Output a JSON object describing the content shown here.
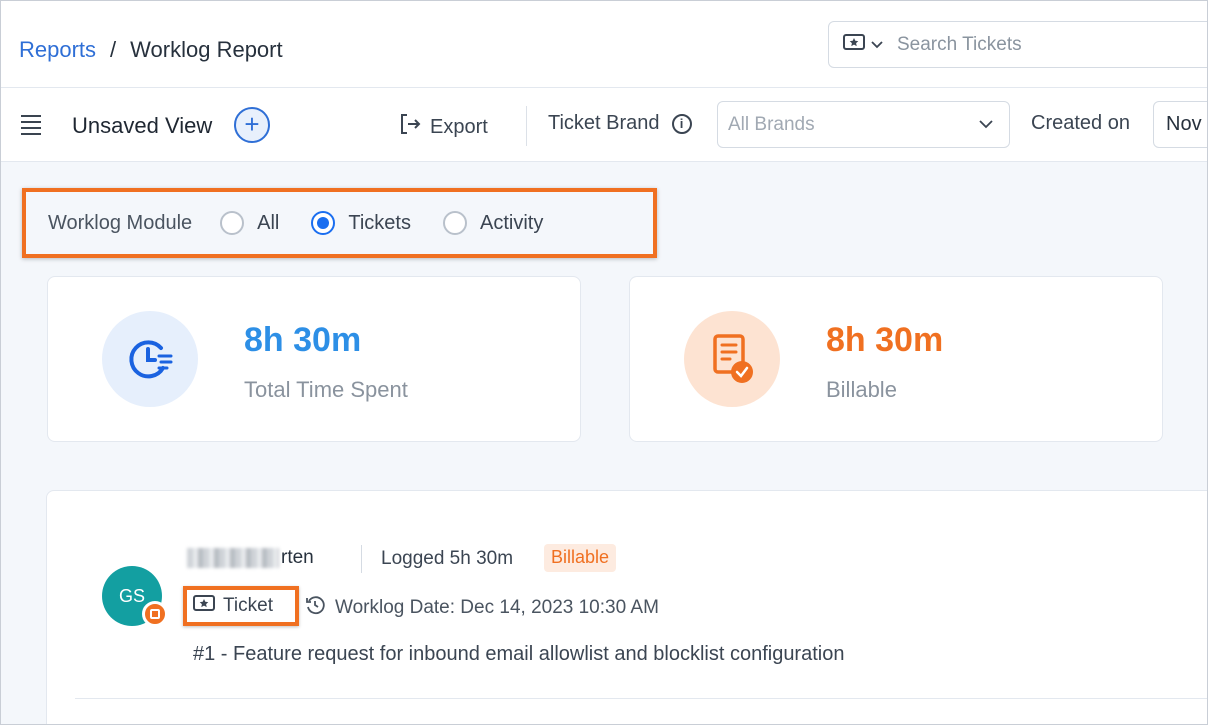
{
  "header": {
    "breadcrumb_root": "Reports",
    "breadcrumb_sep": "/",
    "breadcrumb_current": "Worklog Report",
    "search_placeholder": "Search Tickets"
  },
  "toolbar": {
    "view_name": "Unsaved View",
    "add_view_symbol": "+",
    "export_label": "Export",
    "brand_label": "Ticket Brand",
    "brand_placeholder": "All Brands",
    "created_label": "Created on",
    "created_value": "Nov"
  },
  "module": {
    "label": "Worklog Module",
    "options": [
      {
        "label": "All",
        "checked": false
      },
      {
        "label": "Tickets",
        "checked": true
      },
      {
        "label": "Activity",
        "checked": false
      }
    ]
  },
  "stats": {
    "total": {
      "value": "8h 30m",
      "label": "Total Time Spent",
      "color": "#2d8fe6"
    },
    "billable": {
      "value": "8h 30m",
      "label": "Billable",
      "color": "#f07021"
    }
  },
  "entry": {
    "avatar_initials": "GS",
    "agent_name_visible": "rten",
    "logged": "Logged 5h 30m",
    "billable_tag": "Billable",
    "type_label": "Ticket",
    "worklog_date": "Worklog Date: Dec 14, 2023 10:30 AM",
    "subject": "#1 - Feature request for inbound email allowlist and blocklist configuration"
  },
  "colors": {
    "accent_blue": "#2f6fd6",
    "highlight_orange": "#f07021"
  }
}
